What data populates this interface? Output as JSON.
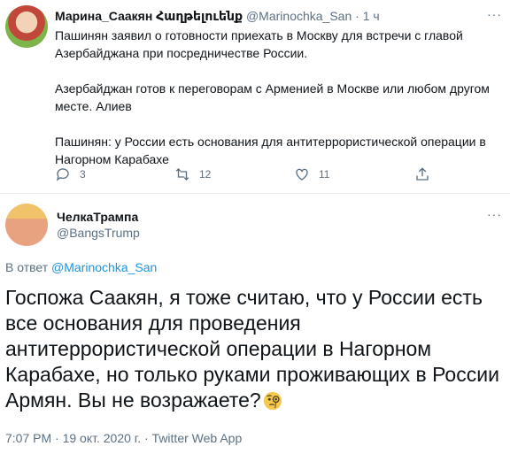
{
  "tweet1": {
    "name": "Марина_Саакян Հաղթելուենք",
    "handle": "@Marinochka_San",
    "sep": "·",
    "time": "1 ч",
    "more": "···",
    "paragraphs": [
      "Пашинян заявил о готовности приехать в Москву для встречи с главой Азербайджана при посредничестве России.",
      "Азербайджан готов к переговорам с Арменией в Москве или любом другом месте. Алиев",
      "Пашинян: у России есть основания для антитеррористической операции в Нагорном Карабахе"
    ],
    "replies": "3",
    "retweets": "12",
    "likes": "11"
  },
  "tweet2": {
    "name": "ЧелкаТрампа",
    "handle": "@BangsTrump",
    "more": "···",
    "reply_prefix": "В ответ",
    "reply_to": "@Marinochka_San",
    "text": "Госпожа Саакян, я тоже считаю, что у России есть все основания для проведения антитеррористической операции в Нагорном Карабахе, но только руками проживающих в России Армян. Вы не возражаете?",
    "emoji": "face-with-monocle",
    "time": "7:07 PM",
    "date": "19 окт. 2020 г.",
    "sep": "·",
    "source": "Twitter Web App"
  },
  "colors": {
    "link": "#1b95e0",
    "muted": "#5b7083",
    "text": "#0f1419",
    "divider": "#ebeef0"
  }
}
